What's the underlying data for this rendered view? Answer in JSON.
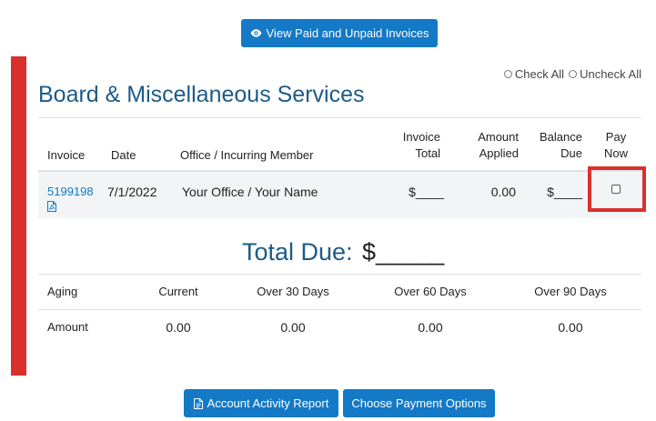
{
  "top_button": {
    "label": "View Paid and Unpaid Invoices"
  },
  "check_options": {
    "check_all": "Check All",
    "uncheck_all": "Uncheck All"
  },
  "section_title": "Board & Miscellaneous Services",
  "invoice_table": {
    "headers": {
      "invoice": "Invoice",
      "date": "Date",
      "office": "Office / Incurring Member",
      "invoice_total_1": "Invoice",
      "invoice_total_2": "Total",
      "amount_applied_1": "Amount",
      "amount_applied_2": "Applied",
      "balance_due_1": "Balance",
      "balance_due_2": "Due",
      "pay_now_1": "Pay",
      "pay_now_2": "Now"
    },
    "rows": [
      {
        "invoice": "5199198",
        "date": "7/1/2022",
        "office": "Your Office / Your Name",
        "invoice_total": "$____",
        "amount_applied": "0.00",
        "balance_due": "$____",
        "pay_now": false
      }
    ]
  },
  "total_due": {
    "label": "Total Due:",
    "value": "$_____"
  },
  "aging_table": {
    "headers": [
      "Aging",
      "Current",
      "Over 30 Days",
      "Over 60 Days",
      "Over 90 Days"
    ],
    "row": [
      "Amount",
      "0.00",
      "0.00",
      "0.00",
      "0.00"
    ]
  },
  "bottom_buttons": {
    "account_activity": "Account Activity Report",
    "payment_options": "Choose Payment Options"
  },
  "colors": {
    "primary_button": "#1479c6",
    "heading": "#1c5b8a",
    "highlight": "#d9302c"
  }
}
